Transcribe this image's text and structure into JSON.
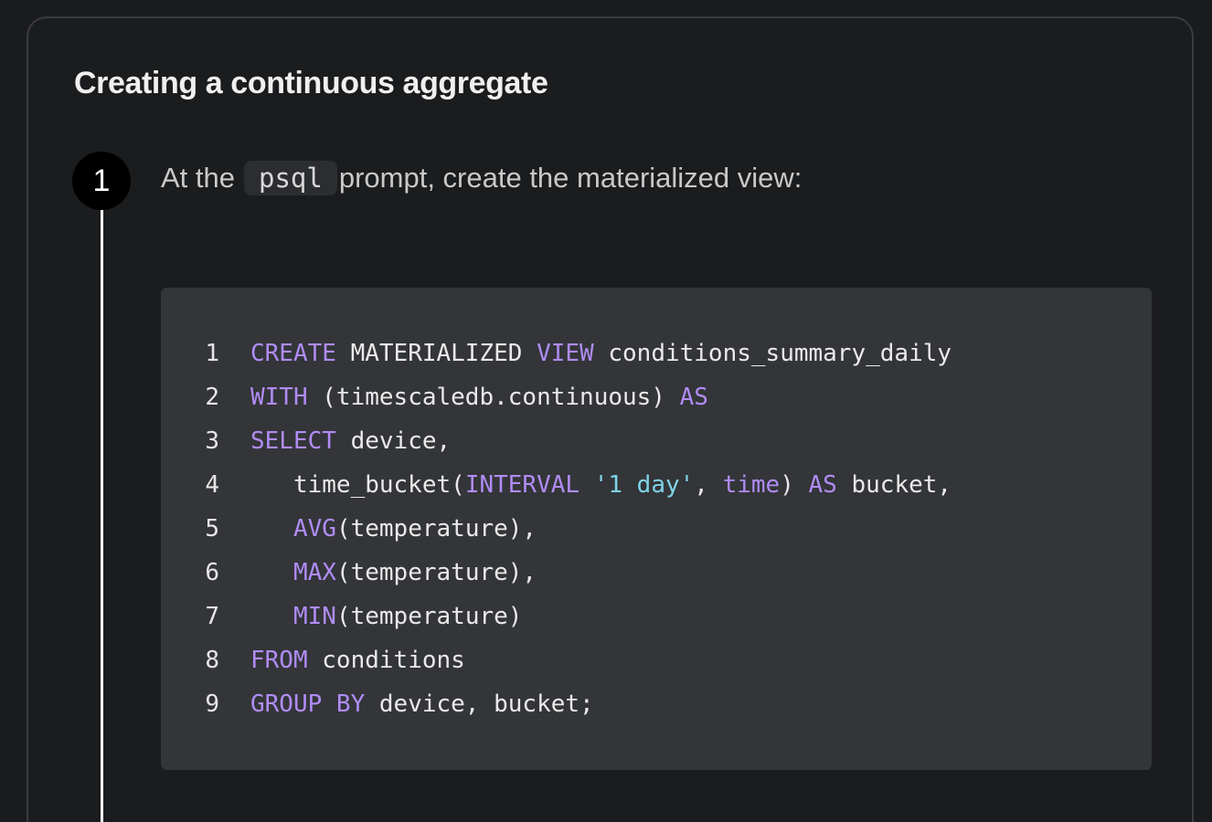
{
  "section": {
    "title": "Creating a continuous aggregate"
  },
  "steps": [
    {
      "number": "1",
      "text_before": "At the",
      "inline_code": "psql",
      "text_after": "prompt, create the materialized view:"
    }
  ],
  "code": {
    "lines": [
      {
        "n": "1",
        "tokens": [
          {
            "t": "CREATE",
            "k": "kw"
          },
          {
            "t": " MATERIALIZED ",
            "k": ""
          },
          {
            "t": "VIEW",
            "k": "kw"
          },
          {
            "t": " conditions_summary_daily",
            "k": ""
          }
        ]
      },
      {
        "n": "2",
        "tokens": [
          {
            "t": "WITH",
            "k": "kw"
          },
          {
            "t": " (timescaledb.continuous) ",
            "k": ""
          },
          {
            "t": "AS",
            "k": "kw"
          }
        ]
      },
      {
        "n": "3",
        "tokens": [
          {
            "t": "SELECT",
            "k": "kw"
          },
          {
            "t": " device,",
            "k": ""
          }
        ]
      },
      {
        "n": "4",
        "tokens": [
          {
            "t": "   time_bucket(",
            "k": ""
          },
          {
            "t": "INTERVAL",
            "k": "kw"
          },
          {
            "t": " ",
            "k": ""
          },
          {
            "t": "'1 day'",
            "k": "str"
          },
          {
            "t": ", ",
            "k": ""
          },
          {
            "t": "time",
            "k": "kw"
          },
          {
            "t": ") ",
            "k": ""
          },
          {
            "t": "AS",
            "k": "kw"
          },
          {
            "t": " bucket,",
            "k": ""
          }
        ]
      },
      {
        "n": "5",
        "tokens": [
          {
            "t": "   ",
            "k": ""
          },
          {
            "t": "AVG",
            "k": "kw"
          },
          {
            "t": "(temperature),",
            "k": ""
          }
        ]
      },
      {
        "n": "6",
        "tokens": [
          {
            "t": "   ",
            "k": ""
          },
          {
            "t": "MAX",
            "k": "kw"
          },
          {
            "t": "(temperature),",
            "k": ""
          }
        ]
      },
      {
        "n": "7",
        "tokens": [
          {
            "t": "   ",
            "k": ""
          },
          {
            "t": "MIN",
            "k": "kw"
          },
          {
            "t": "(temperature)",
            "k": ""
          }
        ]
      },
      {
        "n": "8",
        "tokens": [
          {
            "t": "FROM",
            "k": "kw"
          },
          {
            "t": " conditions",
            "k": ""
          }
        ]
      },
      {
        "n": "9",
        "tokens": [
          {
            "t": "GROUP BY",
            "k": "kw"
          },
          {
            "t": " device, bucket;",
            "k": ""
          }
        ]
      }
    ]
  },
  "colors": {
    "keyword": "#b08cf5",
    "string": "#7fd3e8",
    "code_background": "#333538",
    "page_background": "#1a1b1d"
  }
}
